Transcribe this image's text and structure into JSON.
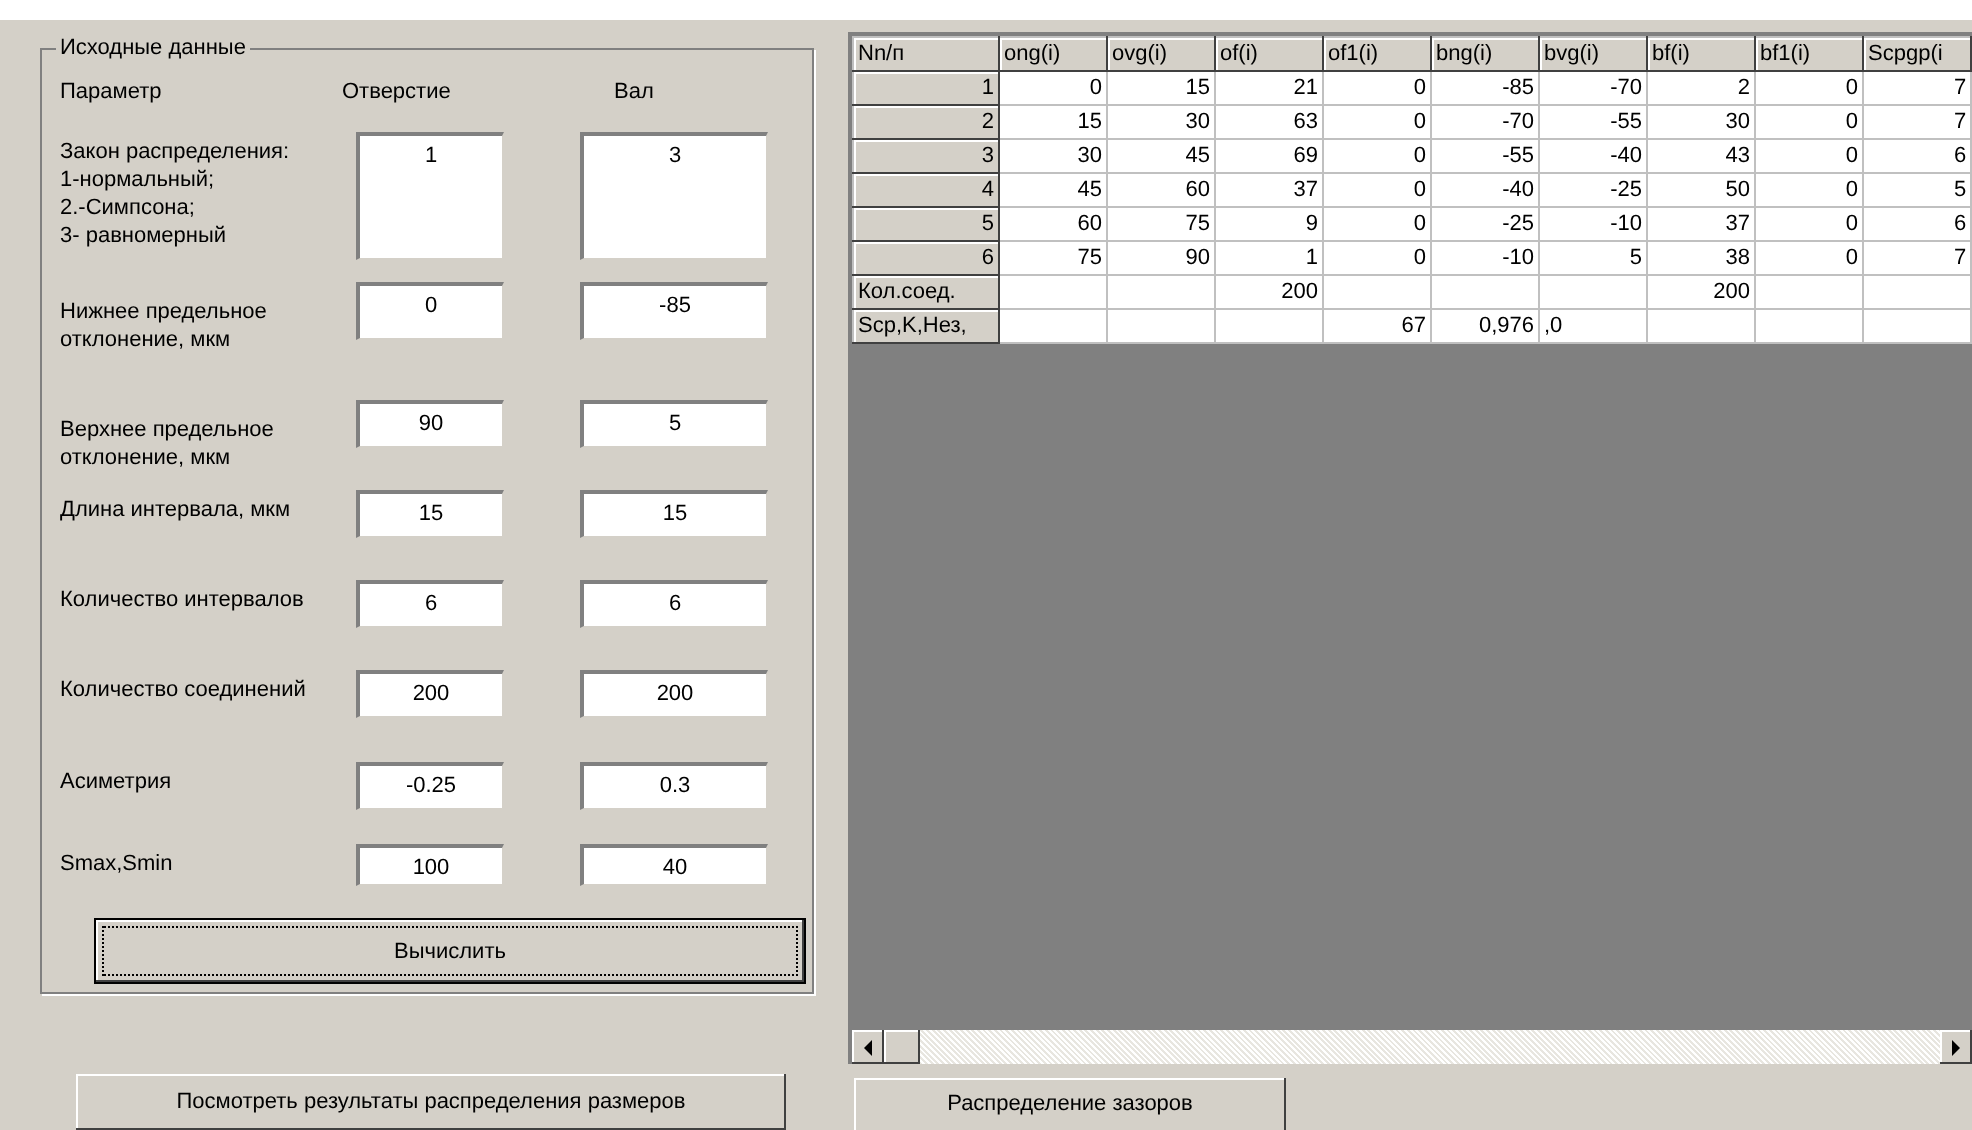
{
  "input_group": {
    "title": "Исходные данные",
    "headers": [
      "Параметр",
      "Отверстие",
      "Вал"
    ],
    "rows": [
      {
        "label": "Закон распределения:\n1-нормальный;\n2.-Симпсона;\n3- равномерный",
        "hole": "1",
        "shaft": "3"
      },
      {
        "label": "Нижнее предельное\nотклонение, мкм",
        "hole": "0",
        "shaft": "-85"
      },
      {
        "label": "Верхнее предельное\nотклонение, мкм",
        "hole": "90",
        "shaft": "5"
      },
      {
        "label": "Длина интервала, мкм",
        "hole": "15",
        "shaft": "15"
      },
      {
        "label": "Количество интервалов",
        "hole": "6",
        "shaft": "6"
      },
      {
        "label": "Количество соединений",
        "hole": "200",
        "shaft": "200"
      },
      {
        "label": "Асиметрия",
        "hole": "-0.25",
        "shaft": "0.3"
      },
      {
        "label": "Smax,Smin",
        "hole": "100",
        "shaft": "40"
      }
    ],
    "calculate_button": "Вычислить"
  },
  "results_button": "Посмотреть результаты распределения размеров",
  "table": {
    "corner": "Nn/п",
    "columns": [
      "ong(i)",
      "ovg(i)",
      "of(i)",
      "of1(i)",
      "bng(i)",
      "bvg(i)",
      "bf(i)",
      "bf1(i)",
      "Scpgp(i"
    ],
    "rows": [
      {
        "header": "1",
        "cells": [
          "0",
          "15",
          "21",
          "0",
          "-85",
          "-70",
          "2",
          "0",
          "7"
        ]
      },
      {
        "header": "2",
        "cells": [
          "15",
          "30",
          "63",
          "0",
          "-70",
          "-55",
          "30",
          "0",
          "7"
        ]
      },
      {
        "header": "3",
        "cells": [
          "30",
          "45",
          "69",
          "0",
          "-55",
          "-40",
          "43",
          "0",
          "6"
        ]
      },
      {
        "header": "4",
        "cells": [
          "45",
          "60",
          "37",
          "0",
          "-40",
          "-25",
          "50",
          "0",
          "5"
        ]
      },
      {
        "header": "5",
        "cells": [
          "60",
          "75",
          "9",
          "0",
          "-25",
          "-10",
          "37",
          "0",
          "6"
        ]
      },
      {
        "header": "6",
        "cells": [
          "75",
          "90",
          "1",
          "0",
          "-10",
          "5",
          "38",
          "0",
          "7"
        ]
      },
      {
        "header": "Кол.соед.",
        "cells": [
          "",
          "",
          "200",
          "",
          "",
          "",
          "200",
          "",
          ""
        ]
      },
      {
        "header": "Scp,K,Нез,",
        "cells": [
          "",
          "",
          "",
          "67",
          "0,976",
          ",0",
          "",
          "",
          ""
        ]
      }
    ]
  },
  "gaps_button": "Распределение зазоров"
}
